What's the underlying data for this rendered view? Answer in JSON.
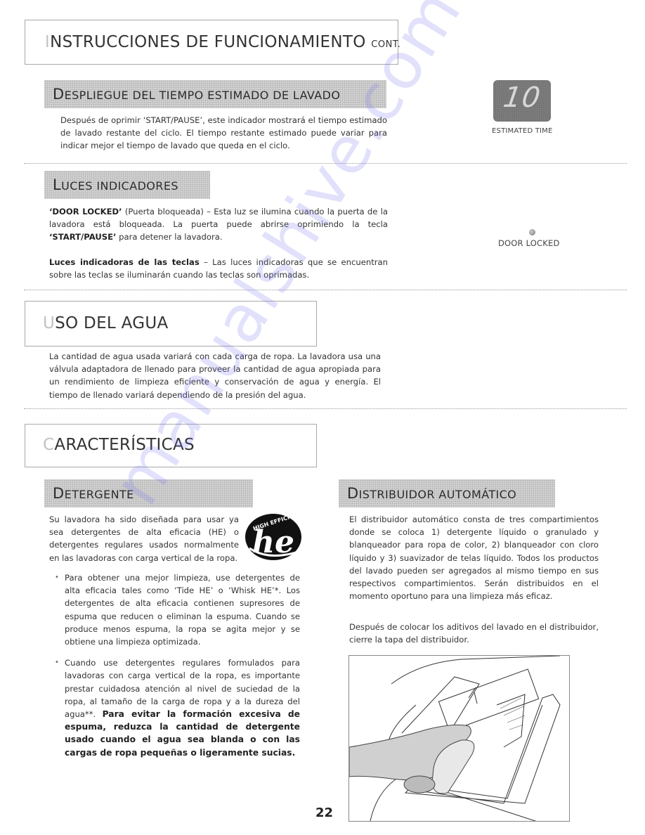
{
  "page": {
    "title_first_letter": "I",
    "title_rest": "NSTRUCCIONES DE FUNCIONAMIENTO",
    "title_suffix": "CONT.",
    "page_number": "22",
    "watermark": "manualshive.com"
  },
  "sections": {
    "estimated_time": {
      "heading_cap": "D",
      "heading_rest": "ESPLIEGUE DEL TIEMPO ESTIMADO DE LAVADO",
      "body": "Después de oprimir ‘START/PAUSE’, este indicador mostrará el tiempo estimado de lavado restante del ciclo. El tiempo restante estimado puede variar para indicar mejor el tiempo de lavado que queda en el ciclo.",
      "display_value": "10",
      "display_label": "ESTIMATED TIME"
    },
    "indicator_lights": {
      "heading_cap": "L",
      "heading_rest": "UCES INDICADORES",
      "door_locked_term": "‘DOOR LOCKED’",
      "door_locked_text": " (Puerta bloqueada) – Esta luz se ilumina cuando la puerta de la lavadora está bloqueada. La puerta puede abrirse oprimiendo la tecla ",
      "start_pause_term": "‘START/PAUSE’",
      "door_locked_text_end": " para detener la lavadora.",
      "key_lights_term": "Luces indicadoras de las teclas",
      "key_lights_text": " – Las luces indicadoras que se encuentran sobre las teclas se iluminarán cuando las teclas son oprimadas.",
      "indicator_label": "DOOR LOCKED"
    },
    "water_usage": {
      "title_first_letter": "U",
      "title_rest": "SO DEL AGUA",
      "body": "La cantidad de agua usada variará con cada carga de ropa. La lavadora usa una válvula adaptadora de llenado para proveer la cantidad de agua apropiada para un rendimiento de limpieza eficiente y conservación de agua y energía. El tiempo de llenado variará dependiendo de la presión del agua."
    },
    "features": {
      "title_first_letter": "C",
      "title_rest": "ARACTERÍSTICAS"
    },
    "detergent": {
      "heading_cap": "D",
      "heading_rest": "ETERGENTE",
      "intro": "Su lavadora ha sido diseñada para usar ya sea detergentes de alta eficacia (HE) o detergentes regulares usados normalmente en las lavadoras con carga vertical de la ropa.",
      "logo_text_arc": "HIGH EFFICIENCY",
      "logo_text_main": "he",
      "bullet_1": "Para obtener una mejor limpieza, use detergentes de alta eficacia tales como ‘Tide HE’ o ‘Whisk HE’*. Los detergentes de alta eficacia contienen supresores de espuma que reducen o eliminan la espuma. Cuando se produce menos espuma, la ropa se agita mejor y se obtiene una limpieza optimizada.",
      "bullet_2_text": "Cuando use detergentes regulares formulados para lavadoras con carga vertical de la ropa, es importante prestar cuidadosa atención al nivel de suciedad de la ropa, al tamaño de la carga de ropa y a la dureza del agua**. ",
      "bullet_2_bold": "Para evitar la formación excesiva de espuma, reduzca la cantidad de detergente usado cuando el agua sea blanda o con las cargas de ropa pequeñas o ligeramente sucias."
    },
    "dispenser": {
      "heading_cap": "D",
      "heading_rest": "ISTRIBUIDOR AUTOMÁTICO",
      "body_1": "El distribuidor automático consta de tres compartimientos donde se coloca 1) detergente líquido o granulado y blanqueador para ropa de color, 2) blanqueador con cloro líquido y 3) suavizador de telas líquido. Todos los productos del lavado pueden ser agregados al mismo tiempo en sus respectivos compartimientos. Serán distribuidos en el momento oportuno para una limpieza más eficaz.",
      "body_2": "Después de colocar los aditivos del lavado en el distribuidor, cierre la tapa del distribuidor."
    }
  }
}
